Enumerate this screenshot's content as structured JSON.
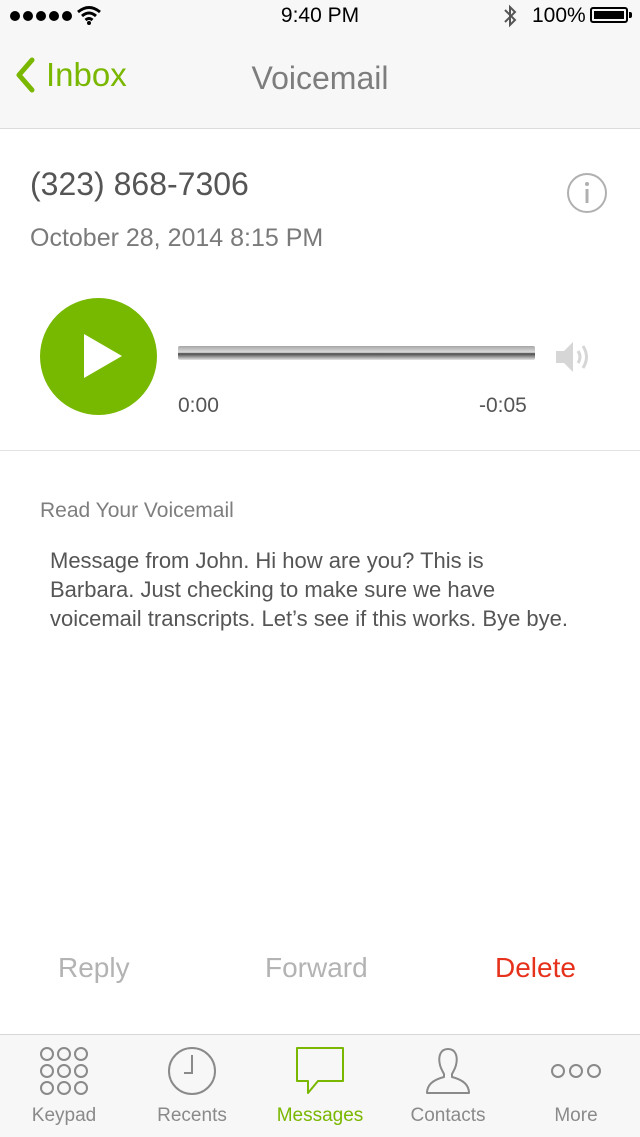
{
  "status_bar": {
    "time": "9:40 PM",
    "battery": "100%"
  },
  "nav": {
    "back_label": "Inbox",
    "title": "Voicemail"
  },
  "voicemail": {
    "phone": "(323) 868-7306",
    "datetime": "October 28, 2014 8:15 PM",
    "elapsed": "0:00",
    "remaining": "-0:05",
    "playback_progress": 0
  },
  "transcript": {
    "heading": "Read Your Voicemail",
    "text": "Message from John.  Hi how are you? This is Barbara. Just checking to make sure we have voicemail transcripts. Let’s see if this works. Bye bye."
  },
  "actions": {
    "reply": "Reply",
    "forward": "Forward",
    "delete": "Delete"
  },
  "tabs": [
    {
      "label": "Keypad",
      "icon": "keypad-icon"
    },
    {
      "label": "Recents",
      "icon": "clock-icon"
    },
    {
      "label": "Messages",
      "icon": "speech-bubble-icon",
      "active": true
    },
    {
      "label": "Contacts",
      "icon": "person-icon"
    },
    {
      "label": "More",
      "icon": "more-icon"
    }
  ],
  "colors": {
    "accent": "#7ab700",
    "play_button": "#77b800",
    "delete": "#e6321c",
    "inactive_action": "#b3b3b3"
  }
}
